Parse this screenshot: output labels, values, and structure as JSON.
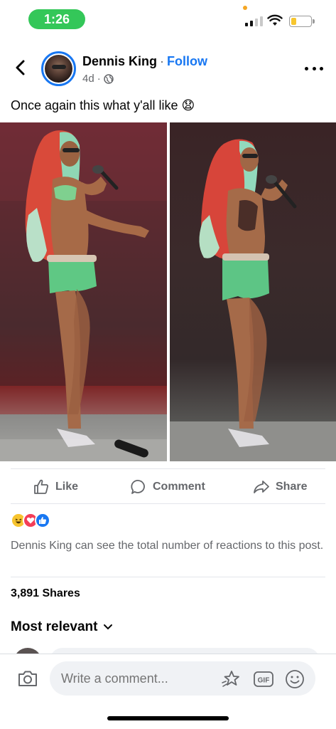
{
  "status_bar": {
    "time": "1:26",
    "battery_level": 0.28
  },
  "post": {
    "author": "Dennis King",
    "separator": "·",
    "follow_label": "Follow",
    "time_ago": "4d",
    "meta_separator": "·",
    "audience_icon": "globe-icon",
    "caption": "Once again this what y'all like 😧"
  },
  "actions": {
    "like_label": "Like",
    "comment_label": "Comment",
    "share_label": "Share"
  },
  "reactions": {
    "types": [
      "haha",
      "love",
      "like"
    ],
    "note": "Dennis King can see the total number of reactions to this post."
  },
  "shares": "3,891 Shares",
  "comments": {
    "sort_label": "Most relevant",
    "composer_placeholder": "Write a comment..."
  },
  "colors": {
    "accent": "#1877f2",
    "time_pill": "#34c759",
    "secondary_text": "#65676b"
  }
}
